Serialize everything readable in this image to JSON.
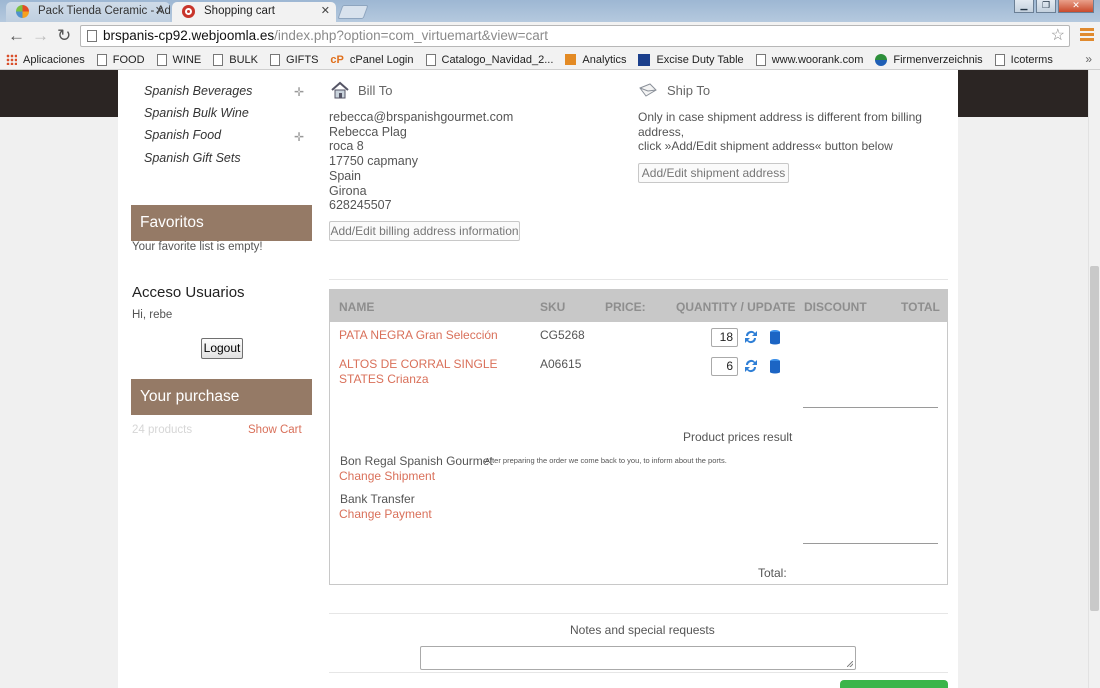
{
  "browser": {
    "tabs": [
      {
        "label": "Pack Tienda Ceramic - Ad",
        "active": false
      },
      {
        "label": "Shopping cart",
        "active": true
      }
    ],
    "url_host": "brspanis-cp92.webjoomla.es",
    "url_path": "/index.php?option=com_virtuemart&view=cart",
    "bookmarks": [
      {
        "label": "Aplicaciones",
        "icon": "apps-grid-icon"
      },
      {
        "label": "FOOD",
        "icon": "page-icon"
      },
      {
        "label": "WINE",
        "icon": "page-icon"
      },
      {
        "label": "BULK",
        "icon": "page-icon"
      },
      {
        "label": "GIFTS",
        "icon": "page-icon"
      },
      {
        "label": "cPanel Login",
        "icon": "cpanel-icon"
      },
      {
        "label": "Catalogo_Navidad_2...",
        "icon": "page-icon"
      },
      {
        "label": "Analytics",
        "icon": "analytics-icon"
      },
      {
        "label": "Excise Duty Table",
        "icon": "excise-icon"
      },
      {
        "label": "www.woorank.com",
        "icon": "page-icon"
      },
      {
        "label": "Firmenverzeichnis",
        "icon": "globe-icon"
      },
      {
        "label": "Icoterms",
        "icon": "page-icon"
      }
    ]
  },
  "sidebar": {
    "categories": [
      {
        "label": "Spanish Beverages",
        "expandable": true
      },
      {
        "label": "Spanish Bulk Wine",
        "expandable": false
      },
      {
        "label": "Spanish Food",
        "expandable": true
      },
      {
        "label": "Spanish Gift Sets",
        "expandable": false
      }
    ],
    "favorites": {
      "title": "Favoritos",
      "empty_text": "Your favorite list is empty!"
    },
    "login": {
      "title": "Acceso Usuarios",
      "greeting": "Hi, rebe",
      "logout_label": "Logout"
    },
    "purchase": {
      "title": "Your purchase",
      "count_text": "24 products",
      "show_cart_label": "Show Cart"
    }
  },
  "bill_to": {
    "title": "Bill To",
    "lines": [
      "rebecca@brspanishgourmet.com",
      "Rebecca Plag",
      "roca 8",
      "17750 capmany",
      "Spain",
      "Girona",
      "628245507"
    ],
    "button_label": "Add/Edit billing address information"
  },
  "ship_to": {
    "title": "Ship To",
    "lines": [
      "Only in case shipment address is different from billing",
      "address,",
      "click »Add/Edit shipment address« button below"
    ],
    "button_label": "Add/Edit shipment address"
  },
  "cart": {
    "headers": {
      "name": "NAME",
      "sku": "SKU",
      "price": "PRICE:",
      "quantity": "QUANTITY / UPDATE",
      "discount": "DISCOUNT",
      "total": "TOTAL"
    },
    "items": [
      {
        "name": "PATA NEGRA Gran Selección",
        "sku": "CG5268",
        "quantity": "18"
      },
      {
        "name": "ALTOS DE CORRAL SINGLE STATES Crianza",
        "sku": "A06615",
        "quantity": "6"
      }
    ],
    "prices_result_label": "Product prices result",
    "shipment": {
      "name": "Bon Regal Spanish Gourmet",
      "note": "After preparing the order we come back to you, to inform about the ports.",
      "change_label": "Change Shipment"
    },
    "payment": {
      "name": "Bank Transfer",
      "change_label": "Change Payment"
    },
    "total_label": "Total:"
  },
  "notes": {
    "label": "Notes and special requests",
    "value": ""
  },
  "colors": {
    "module_header": "#957a66",
    "link": "#d9705a",
    "dark_band": "#2b2523",
    "confirm_button": "#3bb54a"
  }
}
